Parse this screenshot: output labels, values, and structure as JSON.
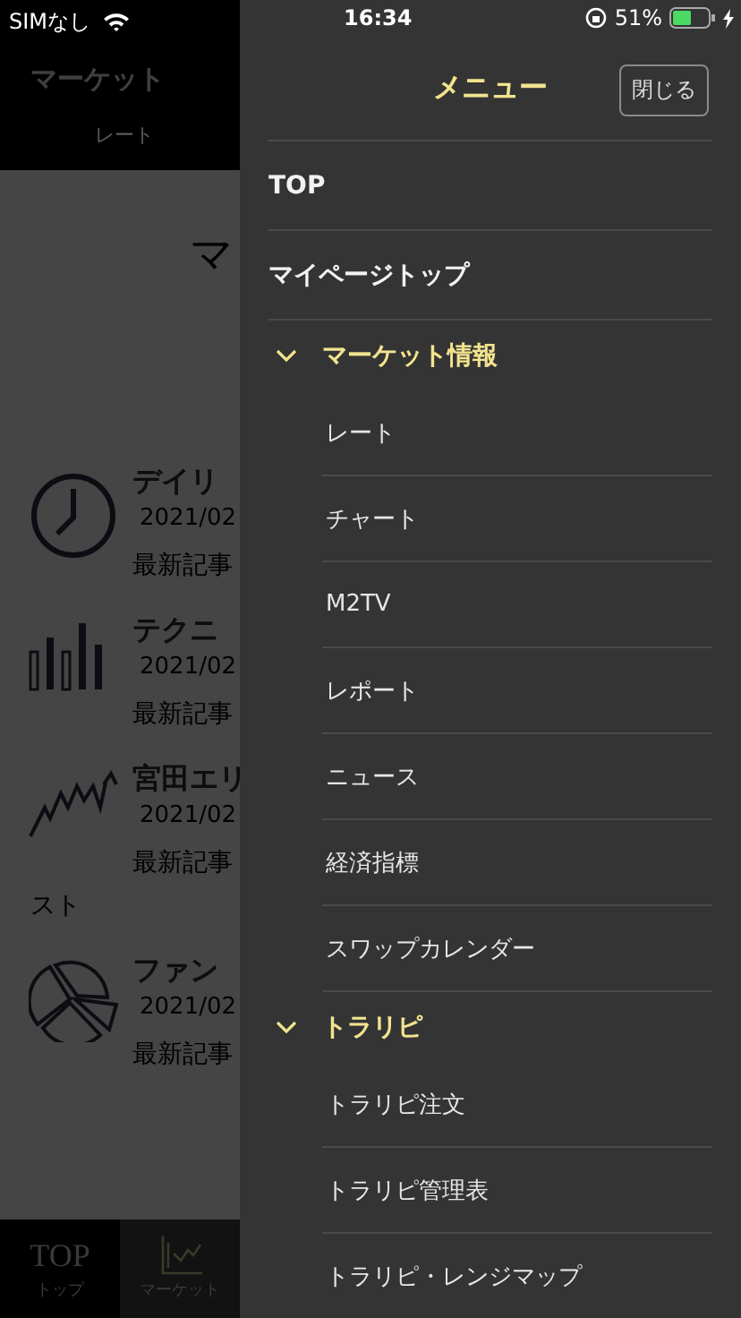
{
  "status_bar": {
    "carrier": "SIMなし",
    "time": "16:34",
    "battery": "51%"
  },
  "background_page": {
    "title": "マーケット",
    "tab": "レート",
    "heading": "マ",
    "articles": [
      {
        "kind": "clock",
        "title": "デイリ",
        "date": "2021/02",
        "excerpt": "最新記事"
      },
      {
        "kind": "bars",
        "title": "テクニ",
        "date": "2021/02",
        "excerpt": "最新記事"
      },
      {
        "kind": "zigzag",
        "title": "宮田エリ",
        "date": "2021/02",
        "excerpt": "最新記事",
        "excerpt_more": "スト"
      },
      {
        "kind": "pie",
        "title": "ファン",
        "date": "2021/02",
        "excerpt": "最新記事"
      }
    ],
    "tab_bar": [
      {
        "kind": "text",
        "mark": "TOP",
        "label": "トップ",
        "selected": false
      },
      {
        "kind": "icon",
        "label": "マーケット",
        "selected": true
      }
    ]
  },
  "menu": {
    "title": "メニュー",
    "close_button": "閉じる",
    "items": [
      {
        "kind": "link",
        "label": "TOP"
      },
      {
        "kind": "link",
        "label": "マイページトップ"
      },
      {
        "kind": "section",
        "label": "マーケット情報",
        "expanded": true,
        "children": [
          "レート",
          "チャート",
          "M2TV",
          "レポート",
          "ニュース",
          "経済指標",
          "スワップカレンダー"
        ]
      },
      {
        "kind": "section",
        "label": "トラリピ",
        "expanded": true,
        "children": [
          "トラリピ注文",
          "トラリピ管理表",
          "トラリピ・レンジマップ"
        ]
      }
    ]
  }
}
